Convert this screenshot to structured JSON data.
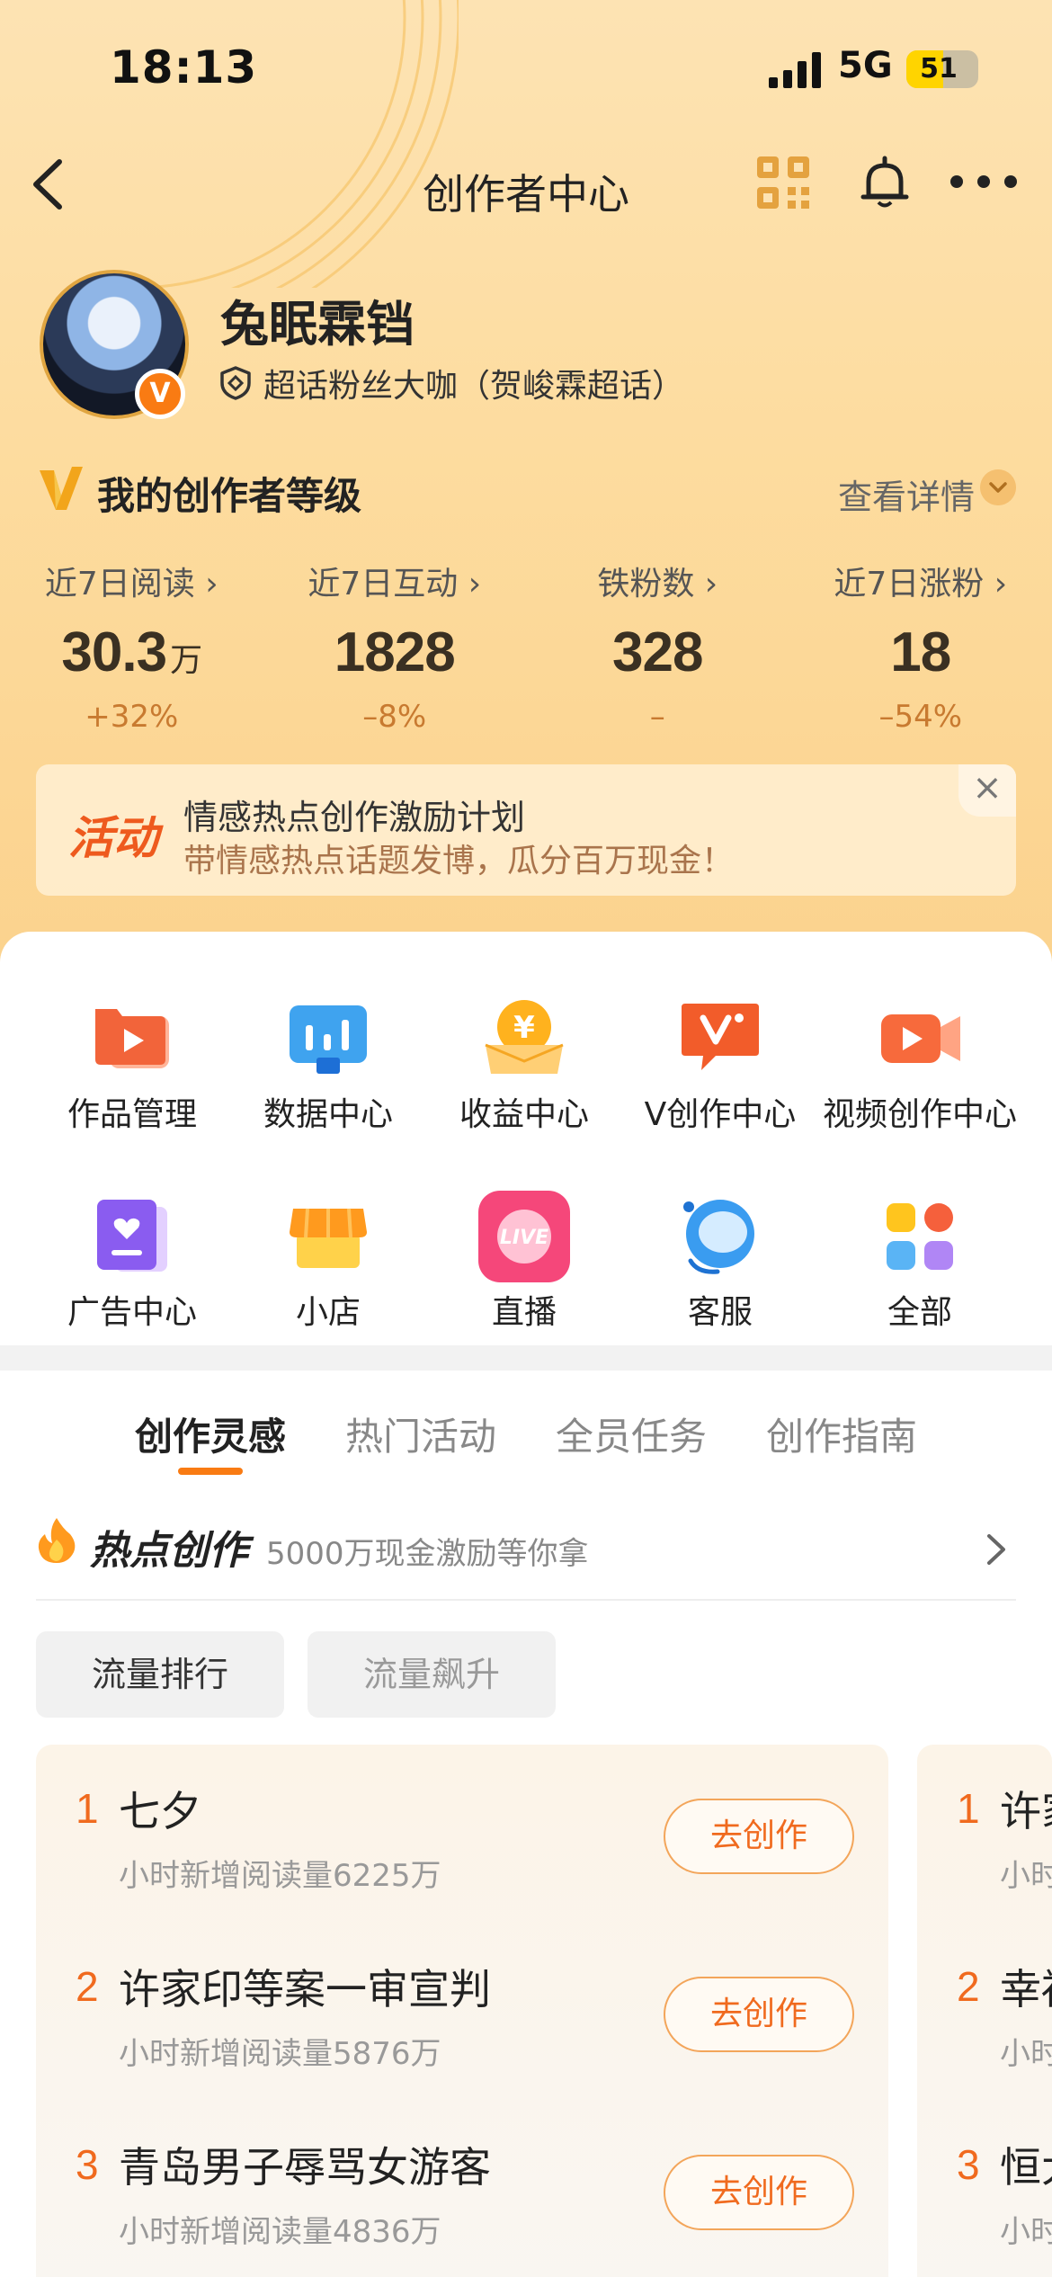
{
  "status_bar": {
    "time": "18:13",
    "network": "5G",
    "battery": "51",
    "battery_level": 0.51
  },
  "nav": {
    "title": "创作者中心"
  },
  "profile": {
    "name": "兔眠霖铛",
    "badge_letter": "V",
    "fan_title": "超话粉丝大咖（贺峻霖超话）"
  },
  "level": {
    "title": "我的创作者等级",
    "detail": "查看详情"
  },
  "stats": [
    {
      "label": "近7日阅读",
      "value": "30.3",
      "unit": "万",
      "change": "+32%"
    },
    {
      "label": "近7日互动",
      "value": "1828",
      "unit": "",
      "change": "–8%"
    },
    {
      "label": "铁粉数",
      "value": "328",
      "unit": "",
      "change": "–"
    },
    {
      "label": "近7日涨粉",
      "value": "18",
      "unit": "",
      "change": "–54%"
    }
  ],
  "activity": {
    "tag": "活动",
    "title": "情感热点创作激励计划",
    "subtitle": "带情感热点话题发博，瓜分百万现金！",
    "close": "×"
  },
  "tools": [
    {
      "label": "作品管理",
      "icon": "works-icon"
    },
    {
      "label": "数据中心",
      "icon": "data-icon"
    },
    {
      "label": "收益中心",
      "icon": "income-icon"
    },
    {
      "label": "V创作中心",
      "icon": "v-creation-icon"
    },
    {
      "label": "视频创作中心",
      "icon": "video-icon"
    },
    {
      "label": "广告中心",
      "icon": "ad-icon"
    },
    {
      "label": "小店",
      "icon": "shop-icon"
    },
    {
      "label": "直播",
      "icon": "live-icon"
    },
    {
      "label": "客服",
      "icon": "service-icon"
    },
    {
      "label": "全部",
      "icon": "all-icon"
    }
  ],
  "live_text": "LIVE",
  "tabs": [
    "创作灵感",
    "热门活动",
    "全员任务",
    "创作指南"
  ],
  "hot": {
    "title": "热点创作",
    "subtitle": "5000万现金激励等你拿"
  },
  "filters": [
    "流量排行",
    "流量飙升"
  ],
  "rank_list": [
    {
      "num": "1",
      "title": "七夕",
      "sub": "小时新增阅读量6225万",
      "button": "去创作"
    },
    {
      "num": "2",
      "title": "许家印等案一审宣判",
      "sub": "小时新增阅读量5876万",
      "button": "去创作"
    },
    {
      "num": "3",
      "title": "青岛男子辱骂女游客",
      "sub": "小时新增阅读量4836万",
      "button": "去创作"
    }
  ],
  "rank_list_2": [
    {
      "num": "1",
      "title": "许家",
      "sub": "小时"
    },
    {
      "num": "2",
      "title": "幸福",
      "sub": "小时"
    },
    {
      "num": "3",
      "title": "恒大",
      "sub": "小时"
    }
  ],
  "colors": {
    "accent": "#f97b13",
    "rank": "#f06a1e",
    "header_bg": "#fddc9f"
  }
}
